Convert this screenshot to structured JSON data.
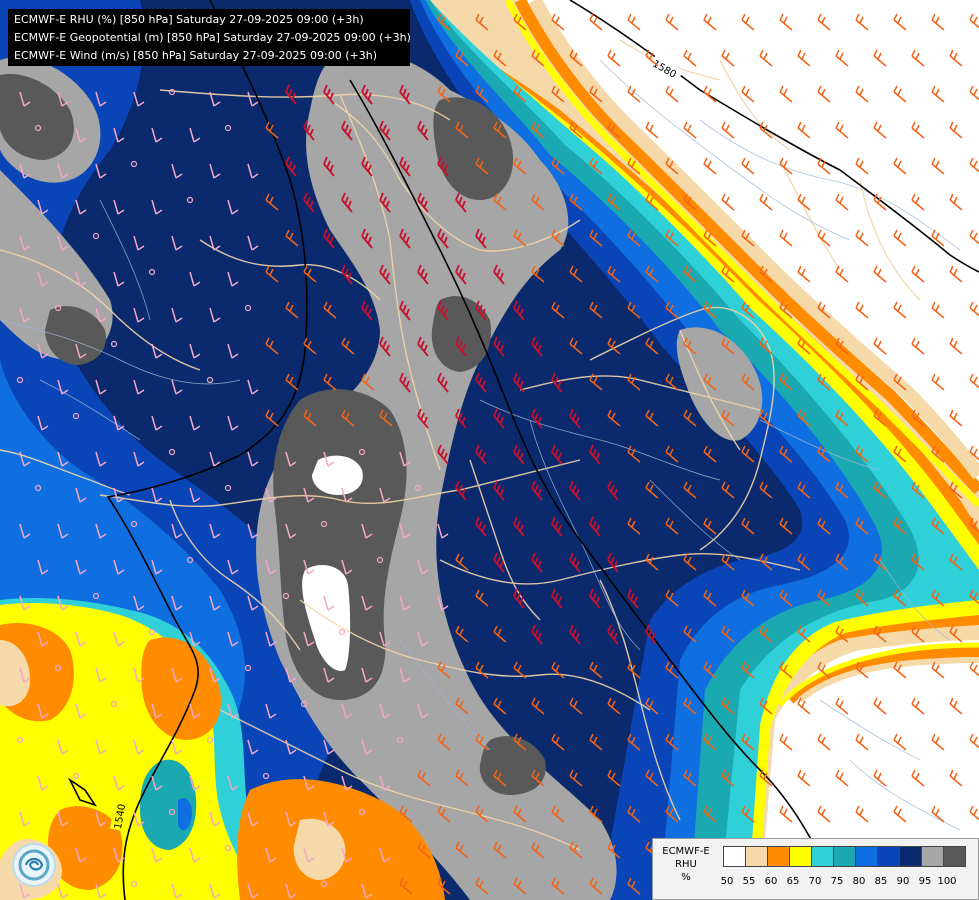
{
  "titles": [
    "ECMWF-E RHU (%) [850 hPa] Saturday 27-09-2025 09:00 (+3h)",
    "ECMWF-E Geopotential (m) [850 hPa] Saturday 27-09-2025 09:00 (+3h)",
    "ECMWF-E Wind (m/s) [850 hPa] Saturday 27-09-2025 09:00 (+3h)"
  ],
  "legend": {
    "label_lines": [
      "ECMWF-E",
      "RHU",
      "%"
    ],
    "ticks": [
      "50",
      "55",
      "60",
      "65",
      "70",
      "75",
      "80",
      "85",
      "90",
      "95",
      "100"
    ],
    "colors": [
      "#ffffff",
      "#f5d9a8",
      "#ff8c00",
      "#ffff00",
      "#2fd0d8",
      "#1aa9b0",
      "#0f6ee0",
      "#0a45b8",
      "#0b2a6e",
      "#a6a6a6",
      "#595959"
    ]
  },
  "contours": [
    {
      "label": "1580"
    },
    {
      "label": "1540"
    }
  ],
  "logo": "ecmwf-logo",
  "colors": {
    "wind_pink": "#f4a6c8",
    "wind_orange": "#f06418",
    "wind_red": "#c8102e",
    "border": "#f2d6a8",
    "river": "#9fb6d6",
    "contour": "#000000"
  }
}
